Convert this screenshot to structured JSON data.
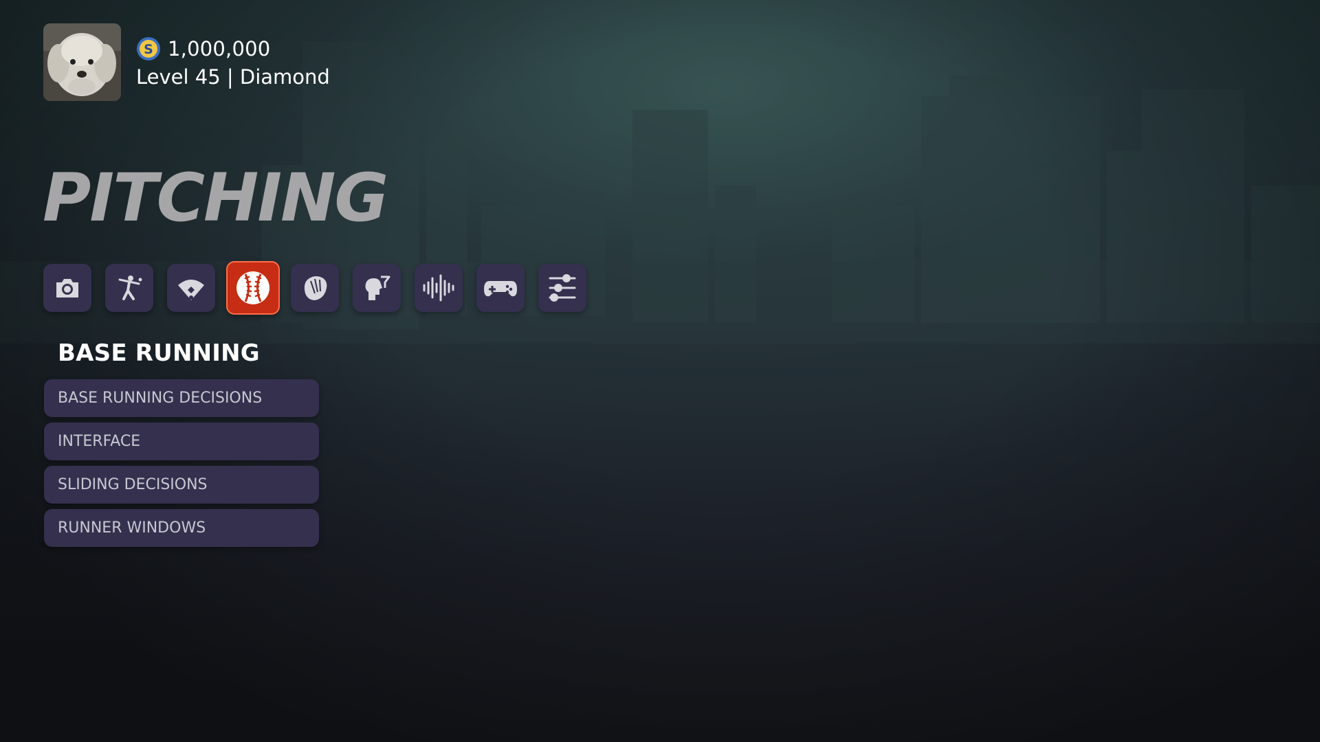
{
  "profile": {
    "currency": "1,000,000",
    "level": "Level 45 | Diamond",
    "avatar_icon": "dog-avatar",
    "coin_icon": "coin-icon"
  },
  "page_title": "PITCHING",
  "categories": [
    {
      "icon": "camera-icon",
      "active": false
    },
    {
      "icon": "batter-icon",
      "active": false
    },
    {
      "icon": "baseball-diamond-icon",
      "active": false
    },
    {
      "icon": "baseball-icon",
      "active": true
    },
    {
      "icon": "glove-icon",
      "active": false
    },
    {
      "icon": "head-strategy-icon",
      "active": false
    },
    {
      "icon": "audio-wave-icon",
      "active": false
    },
    {
      "icon": "gamepad-icon",
      "active": false
    },
    {
      "icon": "sliders-icon",
      "active": false
    }
  ],
  "section": {
    "title": "BASE RUNNING",
    "items": [
      {
        "label": "BASE RUNNING DECISIONS"
      },
      {
        "label": "INTERFACE"
      },
      {
        "label": "SLIDING DECISIONS"
      },
      {
        "label": "RUNNER WINDOWS"
      }
    ]
  },
  "colors": {
    "active_accent": "#c62d14",
    "button_bg": "#34304e",
    "title_gray": "#a6a6a8"
  }
}
